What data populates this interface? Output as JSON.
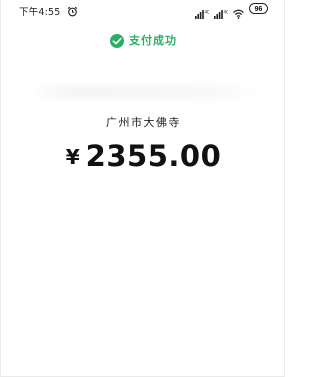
{
  "status_bar": {
    "time": "下午4:55",
    "battery": "96"
  },
  "header": {
    "title": "支付成功",
    "accent_color": "#2aae67",
    "icon": "wechat-pay-icon"
  },
  "payment": {
    "merchant": "广州市大佛寺",
    "currency_symbol": "¥",
    "amount": "2355.00"
  }
}
